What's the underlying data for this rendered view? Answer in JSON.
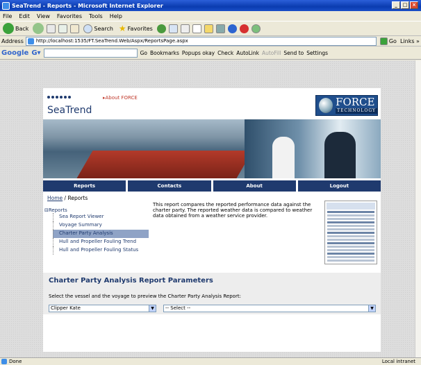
{
  "window": {
    "title": "SeaTrend - Reports - Microsoft Internet Explorer"
  },
  "menu": [
    "File",
    "Edit",
    "View",
    "Favorites",
    "Tools",
    "Help"
  ],
  "toolbar": {
    "back": "Back",
    "search": "Search",
    "favorites": "Favorites"
  },
  "address": {
    "label": "Address",
    "url": "http://localhost:1535/FT.SeaTrend.Web/Aspx/ReportsPage.aspx",
    "go": "Go",
    "links": "Links »"
  },
  "googlebar": {
    "brand": "Google",
    "go": "Go",
    "bookmarks": "Bookmarks",
    "popups": "Popups okay",
    "check": "Check",
    "autolink": "AutoLink",
    "autofill": "AutoFill",
    "sendto": "Send to",
    "settings": "Settings"
  },
  "header": {
    "logo_text": "SeaTrend",
    "about_link": "About FORCE",
    "force_name": "FORCE",
    "force_sub": "TECHNOLOGY"
  },
  "nav": [
    "Reports",
    "Contacts",
    "About",
    "Logout"
  ],
  "breadcrumb": {
    "home": "Home",
    "sep": " / ",
    "current": "Reports"
  },
  "tree": {
    "root": "Reports",
    "items": [
      {
        "label": "Sea Report Viewer",
        "selected": false
      },
      {
        "label": "Voyage Summary",
        "selected": false
      },
      {
        "label": "Charter Party Analysis",
        "selected": true
      },
      {
        "label": "Hull and Propeller Fouling Trend",
        "selected": false
      },
      {
        "label": "Hull and Propeller Fouling Status",
        "selected": false
      }
    ]
  },
  "description": "This report compares the reported performance data against the charter party. The reported weather data is compared to weather data obtained from a weather service provider.",
  "params": {
    "title": "Charter Party Analysis Report Parameters",
    "hint": "Select the vessel and the voyage to preview the Charter Party Analysis Report:",
    "vessel": "Clipper Kate",
    "voyage": "-- Select --"
  },
  "status": {
    "left": "Done",
    "zone": "Local intranet"
  }
}
